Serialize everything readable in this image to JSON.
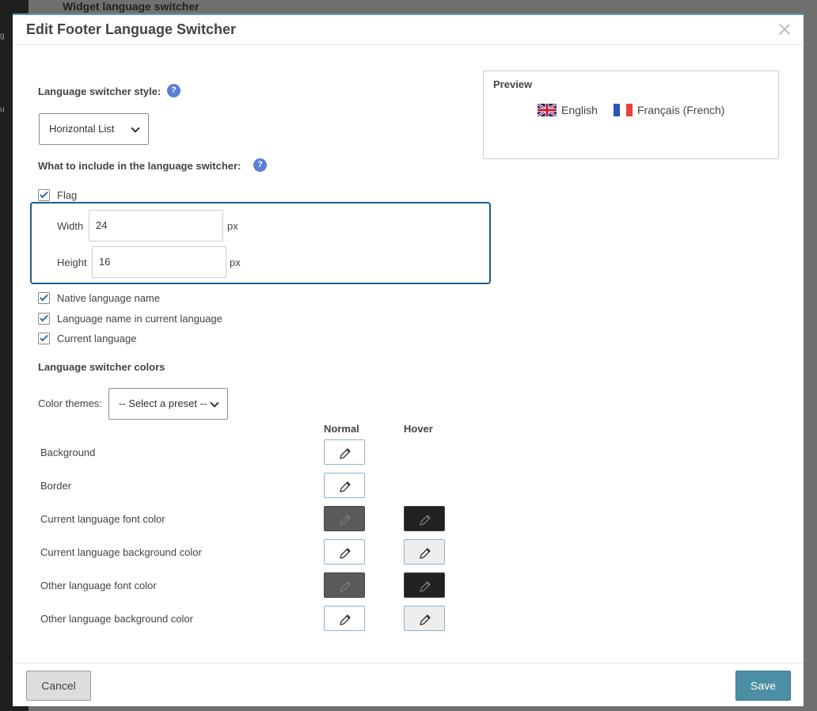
{
  "backdrop": {
    "title": "Widget language switcher",
    "sidebar_ticks": [
      "g",
      "u"
    ]
  },
  "dialog": {
    "title": "Edit Footer Language Switcher"
  },
  "style_section": {
    "label": "Language switcher style:",
    "help": "?",
    "selected_value": "Horizontal List"
  },
  "include_section": {
    "label": "What to include in the language switcher:",
    "help": "?",
    "flag": {
      "label": "Flag",
      "checked": true
    },
    "width": {
      "label": "Width",
      "value": "24",
      "unit": "px"
    },
    "height": {
      "label": "Height",
      "value": "16",
      "unit": "px"
    },
    "options": [
      {
        "label": "Native language name",
        "checked": true
      },
      {
        "label": "Language name in current language",
        "checked": true
      },
      {
        "label": "Current language",
        "checked": true
      }
    ]
  },
  "colors_section": {
    "label": "Language switcher colors",
    "themes_label": "Color themes:",
    "themes_value": "-- Select a preset --",
    "col_normal": "Normal",
    "col_hover": "Hover",
    "rows": [
      {
        "label": "Background",
        "normal": "#ffffff",
        "hover": null
      },
      {
        "label": "Border",
        "normal": "#ffffff",
        "hover": null
      },
      {
        "label": "Current language font color",
        "normal": "#5a5a5a",
        "hover": "#222222"
      },
      {
        "label": "Current language background color",
        "normal": "#ffffff",
        "hover": "#eeeeee"
      },
      {
        "label": "Other language font color",
        "normal": "#5a5a5a",
        "hover": "#222222"
      },
      {
        "label": "Other language background color",
        "normal": "#ffffff",
        "hover": "#eeeeee"
      }
    ]
  },
  "preview": {
    "title": "Preview",
    "languages": [
      {
        "label": "English",
        "flag": "flag-uk-icon"
      },
      {
        "label": "Français (French)",
        "flag": "flag-fr-icon"
      }
    ]
  },
  "footer": {
    "cancel_label": "Cancel",
    "save_label": "Save"
  },
  "colors": {
    "accent": "#4c8ea3",
    "focus_border": "#1f5d8a",
    "help_icon": "#5b7fd6"
  }
}
